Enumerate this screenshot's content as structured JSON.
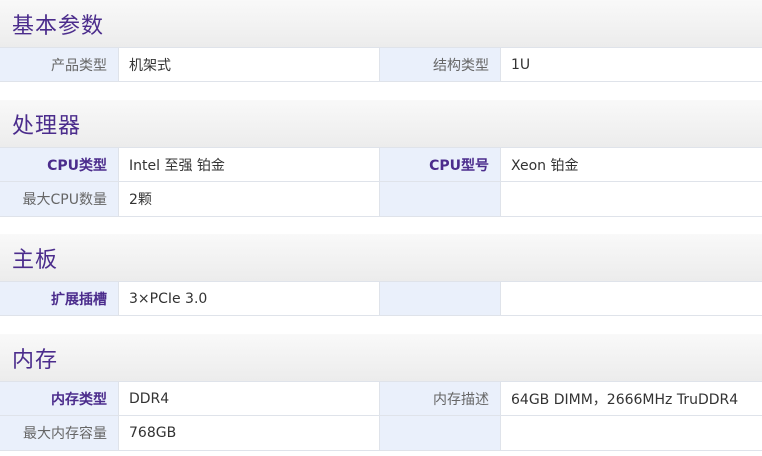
{
  "sections": [
    {
      "title": "基本参数",
      "rows": [
        {
          "k1": "产品类型",
          "v1": "机架式",
          "k2": "结构类型",
          "v2": "1U",
          "bold1": false,
          "bold2": false
        }
      ]
    },
    {
      "title": "处理器",
      "rows": [
        {
          "k1": "CPU类型",
          "v1": "Intel 至强 铂金",
          "k2": "CPU型号",
          "v2": "Xeon 铂金",
          "bold1": true,
          "bold2": true
        },
        {
          "k1": "最大CPU数量",
          "v1": "2颗",
          "k2": "",
          "v2": "",
          "bold1": false,
          "bold2": false
        }
      ]
    },
    {
      "title": "主板",
      "rows": [
        {
          "k1": "扩展插槽",
          "v1": "3×PCIe 3.0",
          "k2": "",
          "v2": "",
          "bold1": true,
          "bold2": false
        }
      ]
    },
    {
      "title": "内存",
      "rows": [
        {
          "k1": "内存类型",
          "v1": "DDR4",
          "k2": "内存描述",
          "v2": "64GB DIMM，2666MHz TruDDR4",
          "bold1": true,
          "bold2": false
        },
        {
          "k1": "最大内存容量",
          "v1": "768GB",
          "k2": "",
          "v2": "",
          "bold1": false,
          "bold2": false
        }
      ]
    }
  ]
}
